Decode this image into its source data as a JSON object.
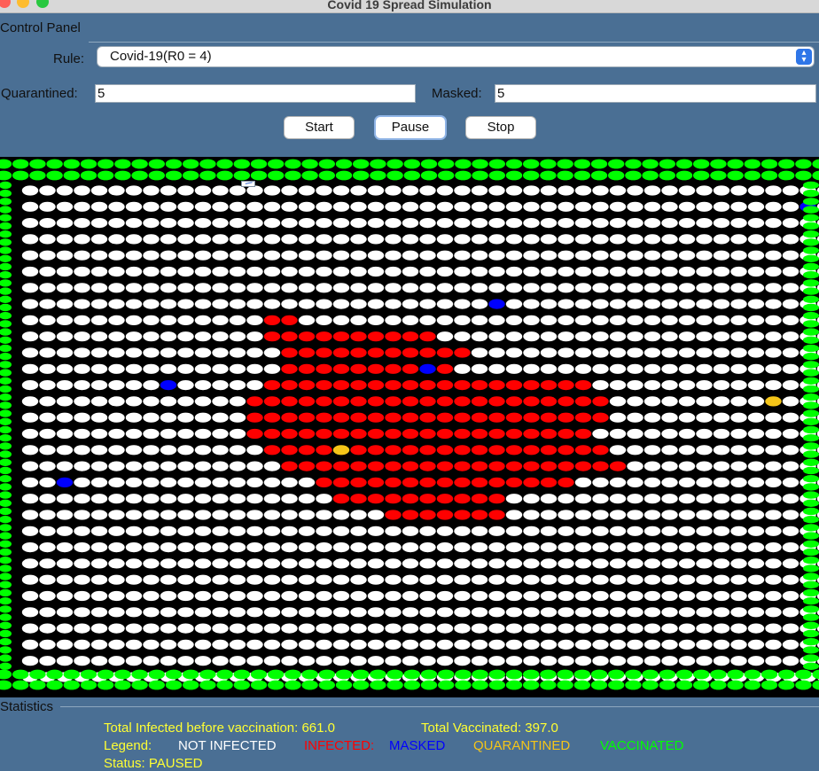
{
  "window": {
    "title": "Covid 19 Spread Simulation"
  },
  "control_panel": {
    "title": "Control Panel",
    "rule_label": "Rule:",
    "rule_value": "Covid-19(R0 = 4)",
    "quarantined_label": "Quarantined:",
    "quarantined_value": "5",
    "masked_label": "Masked:",
    "masked_value": "5",
    "buttons": {
      "start": "Start",
      "pause": "Pause",
      "stop": "Stop"
    }
  },
  "grid": {
    "columns": 47,
    "rows": 31,
    "colors": {
      "not_infected": "#ffffff",
      "infected": "#ff0000",
      "masked": "#0000ff",
      "quarantined": "#f5c518",
      "vaccinated": "#00ff00",
      "background": "#000000"
    },
    "infected_runs": [
      [
        8,
        [
          [
            14,
            15
          ]
        ]
      ],
      [
        9,
        [
          [
            14,
            23
          ]
        ]
      ],
      [
        10,
        [
          [
            15,
            25
          ]
        ]
      ],
      [
        11,
        [
          [
            15,
            24
          ]
        ]
      ],
      [
        12,
        [
          [
            14,
            32
          ]
        ]
      ],
      [
        13,
        [
          [
            13,
            33
          ]
        ]
      ],
      [
        14,
        [
          [
            13,
            33
          ]
        ]
      ],
      [
        15,
        [
          [
            13,
            32
          ]
        ]
      ],
      [
        16,
        [
          [
            14,
            33
          ]
        ]
      ],
      [
        17,
        [
          [
            15,
            34
          ]
        ]
      ],
      [
        18,
        [
          [
            17,
            31
          ]
        ]
      ],
      [
        19,
        [
          [
            18,
            27
          ]
        ]
      ],
      [
        20,
        [
          [
            21,
            27
          ]
        ]
      ]
    ],
    "masked_cells": [
      [
        1,
        45
      ],
      [
        7,
        27
      ],
      [
        11,
        23
      ],
      [
        12,
        8
      ],
      [
        18,
        2
      ]
    ],
    "quarantined_cells": [
      [
        13,
        43
      ],
      [
        16,
        18
      ]
    ]
  },
  "statistics": {
    "title": "Statistics",
    "total_infected": "Total Infected before vaccination: 661.0",
    "total_vaccinated": "Total Vaccinated: 397.0",
    "legend_label": "Legend:",
    "legend_not_infected": "NOT INFECTED",
    "legend_infected": "INFECTED:",
    "legend_masked": "MASKED",
    "legend_quarantined": "QUARANTINED",
    "legend_vaccinated": "VACCINATED",
    "status": "Status: PAUSED",
    "text_color": "#ffff33",
    "white_color": "#ffffff",
    "infected_color": "#ff0000",
    "masked_color": "#0000ff",
    "quarantined_color": "#f5c518",
    "vaccinated_color": "#00ff00"
  }
}
